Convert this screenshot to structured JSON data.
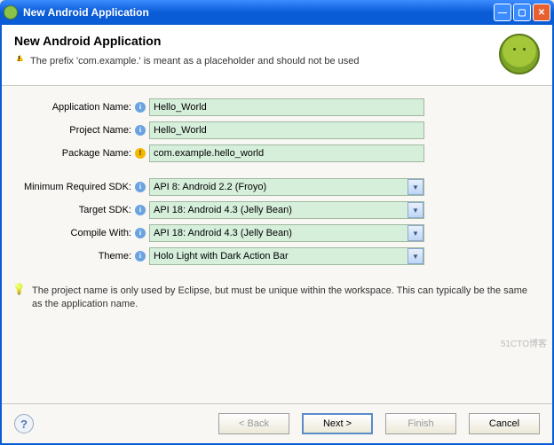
{
  "window": {
    "title": "New Android Application",
    "min": "—",
    "max": "▢",
    "close": "✕"
  },
  "header": {
    "title": "New Android Application",
    "warning": "The prefix 'com.example.' is meant as a placeholder and should not be used"
  },
  "form": {
    "app_name_label": "Application Name:",
    "app_name_value": "Hello_World",
    "project_name_label": "Project Name:",
    "project_name_value": "Hello_World",
    "package_name_label": "Package Name:",
    "package_name_value": "com.example.hello_world",
    "min_sdk_label": "Minimum Required SDK:",
    "min_sdk_value": "API 8: Android 2.2 (Froyo)",
    "target_sdk_label": "Target SDK:",
    "target_sdk_value": "API 18: Android 4.3 (Jelly Bean)",
    "compile_label": "Compile With:",
    "compile_value": "API 18: Android 4.3 (Jelly Bean)",
    "theme_label": "Theme:",
    "theme_value": "Holo Light with Dark Action Bar"
  },
  "hint": "The project name is only used by Eclipse, but must be unique within the workspace. This can typically be the same as the application name.",
  "buttons": {
    "help": "?",
    "back": "< Back",
    "next": "Next >",
    "finish": "Finish",
    "cancel": "Cancel"
  },
  "watermark": "51CTO博客"
}
